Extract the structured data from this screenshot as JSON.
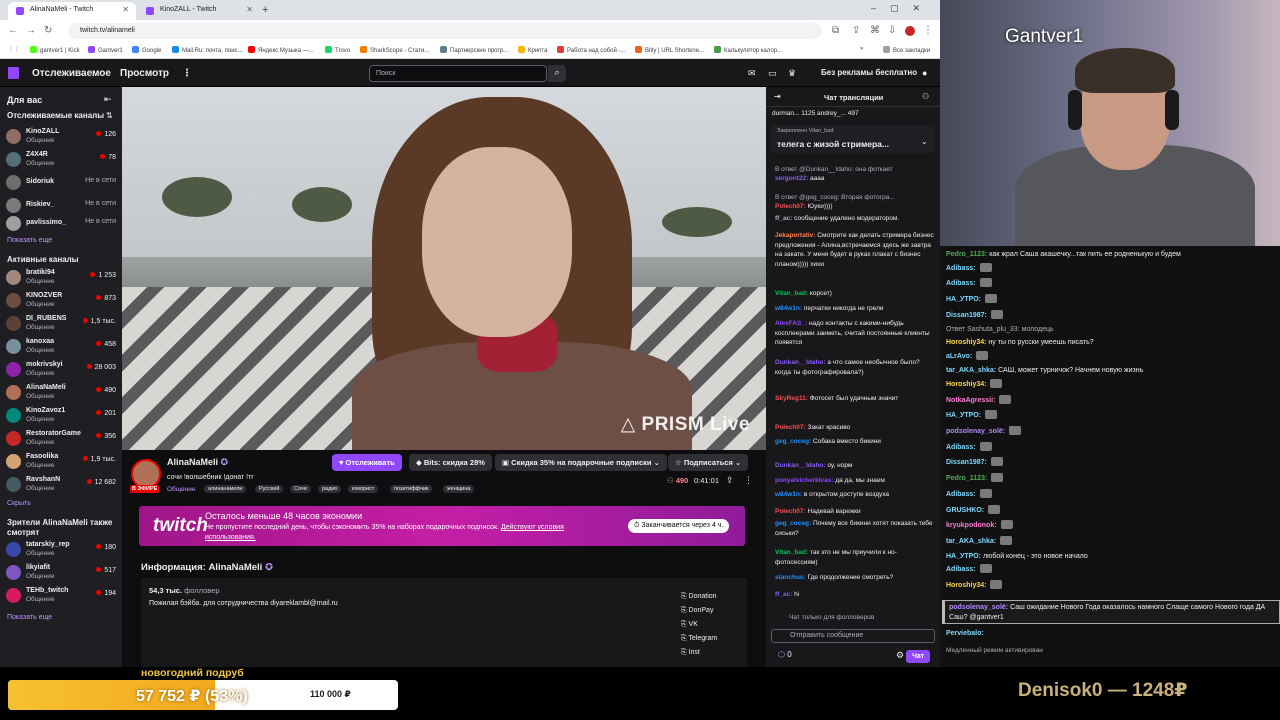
{
  "browser": {
    "tabs": [
      {
        "title": "AlinaNaMeli - Twitch",
        "active": true
      },
      {
        "title": "KinoZALL - Twitch",
        "active": false
      }
    ],
    "url": "twitch.tv/alinameli",
    "bookmarks": [
      "gantver1 | Kick",
      "Gantver1",
      "Google",
      "Mail.Ru: почта, поис...",
      "Яндекс Музыка —...",
      "Trovo",
      "SharkScope - Стати...",
      "Партнерские прогр...",
      "Крипта",
      "Работа над собой -...",
      "Bitly | URL Shortene...",
      "Калькулятор калор...",
      "Все закладки"
    ]
  },
  "twitch": {
    "nav_following": "Отслеживаемое",
    "nav_browse": "Просмотр",
    "search_placeholder": "Поиск",
    "no_ads": "Без рекламы бесплатно"
  },
  "sidebar": {
    "for_you": "Для вас",
    "followed_title": "Отслеживаемые каналы",
    "followed": [
      {
        "name": "KinoZALL",
        "category": "Общение",
        "viewers": "126",
        "live": true
      },
      {
        "name": "Z4X4R",
        "category": "Общение",
        "viewers": "78",
        "live": true
      },
      {
        "name": "Sidoriuk",
        "category": "",
        "viewers": "Не в сети",
        "live": false
      },
      {
        "name": "Riskiev_",
        "category": "",
        "viewers": "Не в сети",
        "live": false
      },
      {
        "name": "pavlissimo_",
        "category": "",
        "viewers": "Не в сети",
        "live": false
      }
    ],
    "show_more": "Показать еще",
    "active_title": "Активные каналы",
    "active": [
      {
        "name": "bratiki94",
        "category": "Общение",
        "viewers": "1 253"
      },
      {
        "name": "KINOZVER",
        "category": "Общение",
        "viewers": "873"
      },
      {
        "name": "DI_RUBENS",
        "category": "Общение",
        "viewers": "1,5 тыс."
      },
      {
        "name": "kanoxaa",
        "category": "Общение",
        "viewers": "458"
      },
      {
        "name": "mokrivskyi",
        "category": "Общение",
        "viewers": "28 003"
      },
      {
        "name": "AlinaNaMeli",
        "category": "Общение",
        "viewers": "490"
      },
      {
        "name": "KinoZavoz1",
        "category": "Общение",
        "viewers": "201"
      },
      {
        "name": "RestoratorGame",
        "category": "Общение",
        "viewers": "356"
      },
      {
        "name": "Fasoolika",
        "category": "Общение",
        "viewers": "1,9 тыс."
      },
      {
        "name": "RavshanN",
        "category": "Общение",
        "viewers": "12 682"
      }
    ],
    "hide": "Скрыть",
    "also_title": "Зрители AlinaNaMeli также смотрят",
    "also": [
      {
        "name": "tatarskiy_rep",
        "category": "Общение",
        "viewers": "180"
      },
      {
        "name": "likyiafit",
        "category": "Общение",
        "viewers": "517"
      },
      {
        "name": "TEHb_twitch",
        "category": "Общение",
        "viewers": "194"
      }
    ],
    "show_more2": "Показать еще"
  },
  "video": {
    "watermark": "PRISM Live"
  },
  "stream": {
    "live_badge": "В ЭФИРЕ",
    "name": "AlinaNaMeli",
    "title": "сочи !волшебник !донат !тг",
    "category": "Общение",
    "tags": [
      "алинанамели",
      "Русский",
      "Сочи",
      "радио",
      "юморист",
      "позитиффчик",
      "женщина"
    ],
    "follow": "Отслеживать",
    "bits": "Bits: скидка 28%",
    "gift": "Скидка 35% на подарочные подписки",
    "subscribe": "Подписаться",
    "viewers": "490",
    "uptime": "0:41:01"
  },
  "promo": {
    "logo": "twitch",
    "title": "Осталось меньше 48 часов экономии",
    "text": "Не пропустите последний день, чтобы сэкономить 35% на наборах подарочных подписок.",
    "link": "Действуют условия использования.",
    "ends": "Заканчивается через 4 ч."
  },
  "about": {
    "heading": "Информация: AlinaNaMeli",
    "followers": "54,3 тыс.",
    "followers_label": "фолловер",
    "description": "Пожилая бэйба. для сотрудничества diyareklambl@mail.ru",
    "socials": [
      "Donation",
      "DonPay",
      "VK",
      "Telegram",
      "Inst"
    ]
  },
  "chat": {
    "title": "Чат трансляции",
    "gifters": "durman... 1125  andrey_... 497",
    "pinned_label": "Закреплено Vitan_bad",
    "pinned_text": "телега с жизой стримера...",
    "messages": [
      {
        "user": "",
        "text": "В ответ @Dunkan__Idaho: она фоткает",
        "color": "#adadb8"
      },
      {
        "user": "sergont22:",
        "text": "аааа",
        "color": "#8a5cf5"
      },
      {
        "user": "",
        "text": "В ответ @geg_coceg: Вторая фотогра...",
        "color": "#adadb8"
      },
      {
        "user": "Polech07:",
        "text": "Юуки))))",
        "color": "#ff4d4d"
      },
      {
        "user": "ff_ac:",
        "text": "сообщение удалено модератором.",
        "color": "#adadb8"
      },
      {
        "user": "Jekaportativ:",
        "text": "Смотрите как делать стримера бизнес предложения - Алина,встречаемся здесь же завтра на закате. У меня будет в руках плакат с бизнес планом))))) хихи",
        "color": "#ff7f50"
      },
      {
        "user": "Vitan_bad:",
        "text": "корсет)",
        "color": "#00c853"
      },
      {
        "user": "w84w1n:",
        "text": "перчатки никогда не грели",
        "color": "#1e90ff"
      },
      {
        "user": "AlexFAS_:",
        "text": "надо контакты с какими-нибудь косплеерами заиметь, считай постоянные клиенты появятся",
        "color": "#9146ff"
      },
      {
        "user": "Dunkan__Idaho:",
        "text": "а что самое необычное было? когда ты фотографировала?)",
        "color": "#8a5cf5"
      },
      {
        "user": "SkyReg11:",
        "text": "Фотосет был удачным значит",
        "color": "#ff4d4d"
      },
      {
        "user": "Polech07:",
        "text": "Закат красиво",
        "color": "#ff4d4d"
      },
      {
        "user": "geg_coceg:",
        "text": "Собака вместо бикини",
        "color": "#1e90ff"
      },
      {
        "user": "Dunkan__Idaho:",
        "text": "оу, норм",
        "color": "#8a5cf5"
      },
      {
        "user": "ponyalvicherkivas:",
        "text": "да да, мы знаем",
        "color": "#9146ff"
      },
      {
        "user": "w84w1n:",
        "text": "в открытом доступе воздуха",
        "color": "#1e90ff"
      },
      {
        "user": "Polech07:",
        "text": "Надевай варежки",
        "color": "#ff4d4d"
      },
      {
        "user": "geg_coceg:",
        "text": "Почему все бикини хотят показать тебе сиськи?",
        "color": "#1e90ff"
      },
      {
        "user": "Vitan_bad:",
        "text": "так это не мы приучили к но-фотосессиям)",
        "color": "#00c853"
      },
      {
        "user": "stanchus:",
        "text": "Где продолжение смотреть?",
        "color": "#1e90ff"
      },
      {
        "user": "ff_ac:",
        "text": "hi",
        "color": "#8a5cf5"
      }
    ],
    "followers_only": "Чат только для фолловеров",
    "placeholder": "Отправить сообщение",
    "points": "0",
    "send": "Чат"
  },
  "overlay": {
    "cam_name": "Gantver1",
    "messages": [
      {
        "user": "Pedro_1123:",
        "text": "как жрал Саша акашечку...так пить ее родненькую и будем",
        "color": "#4caf50",
        "emote": false
      },
      {
        "user": "Adibass:",
        "text": "",
        "color": "#7fd8ff",
        "emote": true
      },
      {
        "user": "Adibass:",
        "text": "",
        "color": "#7fd8ff",
        "emote": true
      },
      {
        "user": "НА_УТРО:",
        "text": "",
        "color": "#7fd8ff",
        "emote": true
      },
      {
        "user": "Dissan1987:",
        "text": "",
        "color": "#7fd8ff",
        "emote": true
      },
      {
        "user": "",
        "text": "Ответ Sashuta_plu_33: молодець",
        "color": "#adadb8",
        "emote": false
      },
      {
        "user": "Horoshiy34:",
        "text": "ну ты по русски умеешь писать?",
        "color": "#ffd54f",
        "emote": false
      },
      {
        "user": "aLrAvo:",
        "text": "",
        "color": "#7fd8ff",
        "emote": true
      },
      {
        "user": "tar_AKA_shka:",
        "text": "САШ, может турничок? Начнем новую жизнь",
        "color": "#7fd8ff",
        "emote": false
      },
      {
        "user": "Horoshiy34:",
        "text": "",
        "color": "#ffd54f",
        "emote": true
      },
      {
        "user": "NotkaAgressii:",
        "text": "",
        "color": "#ff7bd5",
        "emote": true
      },
      {
        "user": "НА_УТРО:",
        "text": "",
        "color": "#7fd8ff",
        "emote": true
      },
      {
        "user": "podsolenay_solё:",
        "text": "",
        "color": "#b388ff",
        "emote": true
      },
      {
        "user": "Adibass:",
        "text": "",
        "color": "#7fd8ff",
        "emote": true
      },
      {
        "user": "Dissan1987:",
        "text": "",
        "color": "#7fd8ff",
        "emote": true
      },
      {
        "user": "Pedro_1123:",
        "text": "",
        "color": "#4caf50",
        "emote": true
      },
      {
        "user": "Adibass:",
        "text": "",
        "color": "#7fd8ff",
        "emote": true
      },
      {
        "user": "GRUSHKO:",
        "text": "",
        "color": "#7fd8ff",
        "emote": true
      },
      {
        "user": "kryukpodonok:",
        "text": "",
        "color": "#ff7bd5",
        "emote": true
      },
      {
        "user": "tar_AKA_shka:",
        "text": "",
        "color": "#7fd8ff",
        "emote": true
      },
      {
        "user": "НА_УТРО:",
        "text": "любой конец - это новое начало",
        "color": "#7fd8ff",
        "emote": false
      },
      {
        "user": "Adibass:",
        "text": "",
        "color": "#7fd8ff",
        "emote": true
      },
      {
        "user": "Horoshiy34:",
        "text": "",
        "color": "#ffd54f",
        "emote": true
      }
    ],
    "highlight_user": "podsolenay_solё:",
    "highlight_text": "Саш ожидание Нового Года оказалось намного Слаще самого Нового года ДА Саш? @gantver1",
    "last_user": "Perviebalo:",
    "slow_mode": "Медленный режим активирован"
  },
  "goal": {
    "title": "новогодний подруб",
    "current": "57 752 ₽ (53%)",
    "target": "110 000 ₽",
    "fraction": 0.53,
    "top_donor": "Denisok0 — 1248₽"
  }
}
